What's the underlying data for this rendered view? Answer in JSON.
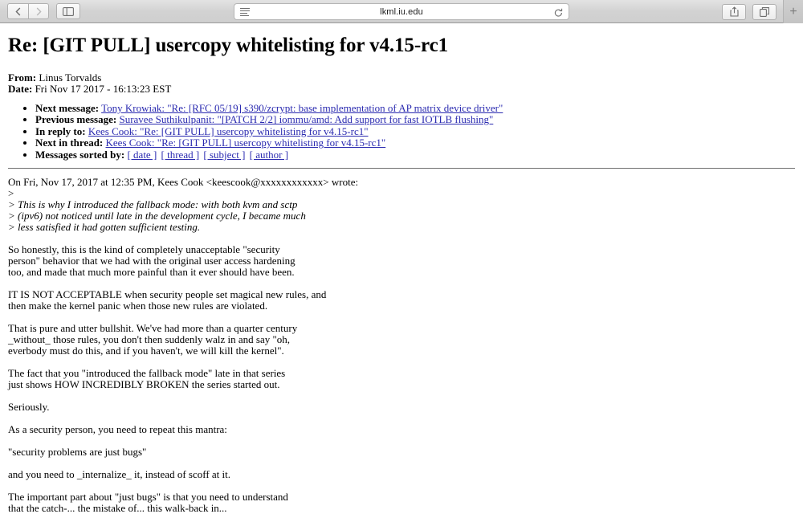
{
  "browser": {
    "back_label": "Back",
    "forward_label": "Forward",
    "sidebar_label": "Show Sidebar",
    "url": "lkml.iu.edu",
    "reader_label": "Reader View",
    "reload_label": "Reload",
    "share_label": "Share",
    "tabs_label": "Show Tab Overview",
    "newtab_label": "+"
  },
  "page": {
    "title": "Re: [GIT PULL] usercopy whitelisting for v4.15-rc1",
    "meta": {
      "from_label": "From:",
      "from_value": "Linus Torvalds",
      "date_label": "Date:",
      "date_value": "Fri Nov 17 2017 - 16:13:23 EST"
    },
    "nav": [
      {
        "label": "Next message:",
        "link": "Tony Krowiak: \"Re: [RFC 05/19] s390/zcrypt: base implementation of AP matrix device driver\""
      },
      {
        "label": "Previous message:",
        "link": "Suravee Suthikulpanit: \"[PATCH 2/2] iommu/amd: Add support for fast IOTLB flushing\""
      },
      {
        "label": "In reply to:",
        "link": "Kees Cook: \"Re: [GIT PULL] usercopy whitelisting for v4.15-rc1\""
      },
      {
        "label": "Next in thread:",
        "link": "Kees Cook: \"Re: [GIT PULL] usercopy whitelisting for v4.15-rc1\""
      }
    ],
    "sorted_by": {
      "label": "Messages sorted by:",
      "options": [
        "[ date ]",
        "[ thread ]",
        "[ subject ]",
        "[ author ]"
      ]
    },
    "message": {
      "attribution": "On Fri, Nov 17, 2017 at 12:35 PM, Kees Cook <keescook@xxxxxxxxxxxx> wrote:",
      "quote_blank": ">",
      "quote_lines": "> This is why I introduced the fallback mode: with both kvm and sctp\n> (ipv6) not noticed until late in the development cycle, I became much\n> less satisfied it had gotten sufficient testing.",
      "paragraphs": [
        "So honestly, this is the kind of completely unacceptable \"security\nperson\" behavior that we had with the original user access hardening\ntoo, and made that much more painful than it ever should have been.",
        "IT IS NOT ACCEPTABLE when security people set magical new rules, and\nthen make the kernel panic when those new rules are violated.",
        "That is pure and utter bullshit. We've had more than a quarter century\n_without_ those rules, you don't then suddenly walz in and say \"oh,\neverbody must do this, and if you haven't, we will kill the kernel\".",
        "The fact that you \"introduced the fallback mode\" late in that series\njust shows HOW INCREDIBLY BROKEN the series started out.",
        "Seriously.",
        "As a security person, you need to repeat this mantra:",
        "\"security problems are just bugs\"",
        "and you need to _internalize_ it, instead of scoff at it.",
        "The important part about \"just bugs\" is that you need to understand\nthat the catch-... the mistake of... this walk-back in..."
      ]
    }
  }
}
